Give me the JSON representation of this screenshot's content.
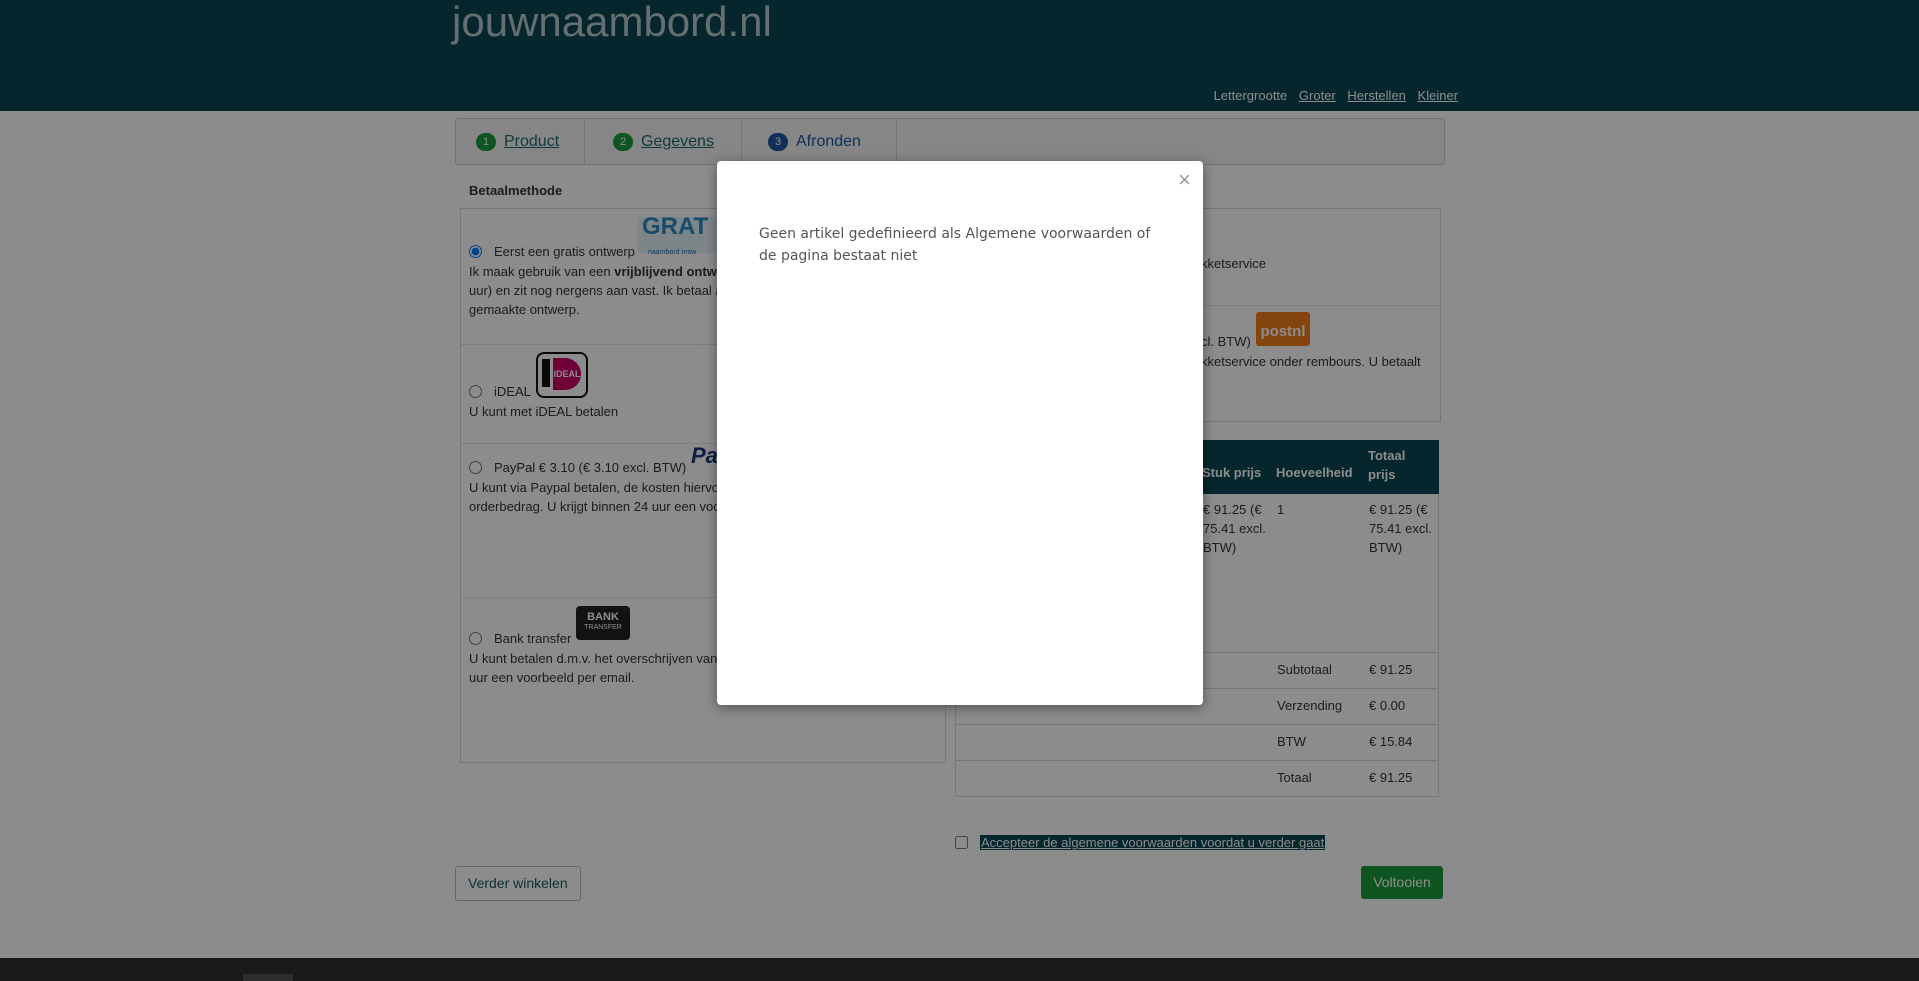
{
  "header": {
    "site_title": "jouwnaambord.nl",
    "fontsize_label": "Lettergrootte",
    "bigger": "Groter",
    "reset": "Herstellen",
    "smaller": "Kleiner"
  },
  "steps": [
    {
      "num": "1",
      "label": "Product"
    },
    {
      "num": "2",
      "label": "Gegevens"
    },
    {
      "num": "3",
      "label": "Afronden"
    }
  ],
  "payment": {
    "title": "Betaalmethode",
    "options": [
      {
        "label": "Eerst een gratis ontwerp",
        "desc_pre": "Ik maak gebruik van een ",
        "desc_bold": "vrijblijvend ontwe",
        "desc_post": "uur) en zit nog nergens aan vast. Ik betaal a",
        "desc_line3": "gemaakte ontwerp.",
        "logo": "GRAT",
        "logo_sub": "naambord ontw"
      },
      {
        "label": "iDEAL",
        "desc": "U kunt met iDEAL betalen",
        "logo": "iDEAL"
      },
      {
        "label": "PayPal € 3.10 (€ 3.10 excl. BTW)",
        "desc1": "U kunt via Paypal betalen, de kosten hiervo",
        "desc2": "orderbedrag. U krijgt binnen 24 uur een voo",
        "logo": "Pa"
      },
      {
        "label": "Bank transfer",
        "desc1": "U kunt betalen d.m.v. het overschrijven van",
        "desc2": "uur een voorbeeld per email.",
        "logo_line1": "BANK",
        "logo_line2": "TRANSFER"
      }
    ]
  },
  "shipping": {
    "opt1_text": "kketservice",
    "opt2_label": "cl. BTW)",
    "opt2_desc": "kketservice onder rembours. U betaalt",
    "logo": "postnl"
  },
  "cart": {
    "headers": {
      "unit": "Stuk prijs",
      "qty": "Hoeveelheid",
      "total1": "Totaal",
      "total2": "prijs"
    },
    "row": {
      "unit": "€ 91.25 (€ 75.41 excl. BTW)",
      "qty": "1",
      "total": "€ 91.25 (€ 75.41 excl. BTW)"
    },
    "summary": [
      {
        "k": "Subtotaal",
        "v": "€ 91.25"
      },
      {
        "k": "Verzending",
        "v": "€ 0.00"
      },
      {
        "k": "BTW",
        "v": "€ 15.84"
      },
      {
        "k": "Totaal",
        "v": "€ 91.25"
      }
    ]
  },
  "accept_text": "Accepteer de algemene voorwaarden voordat u verder gaat",
  "buttons": {
    "continue": "Verder winkelen",
    "finish": "Voltooien"
  },
  "modal": {
    "close": "×",
    "message": "Geen artikel gedefinieerd als Algemene voorwaarden of de pagina bestaat niet"
  },
  "colors": {
    "brand": "#0a4650",
    "green": "#1a9b3e",
    "step_active": "#1f57a0"
  }
}
